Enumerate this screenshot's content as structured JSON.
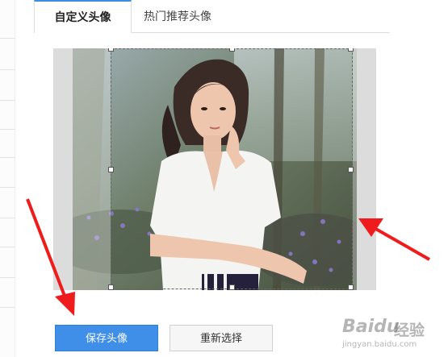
{
  "tabs": [
    {
      "label": "自定义头像",
      "active": true
    },
    {
      "label": "热门推荐头像",
      "active": false
    }
  ],
  "buttons": {
    "save_label": "保存头像",
    "reselect_label": "重新选择"
  },
  "watermark": {
    "brand": "Baidu",
    "brand_cn": "经验",
    "url": "jingyan.baidu.com"
  },
  "colors": {
    "accent": "#3f8ee8",
    "arrow": "#ee1c1c"
  },
  "icons": [
    "paw-logo-icon",
    "red-arrow-annotation"
  ]
}
